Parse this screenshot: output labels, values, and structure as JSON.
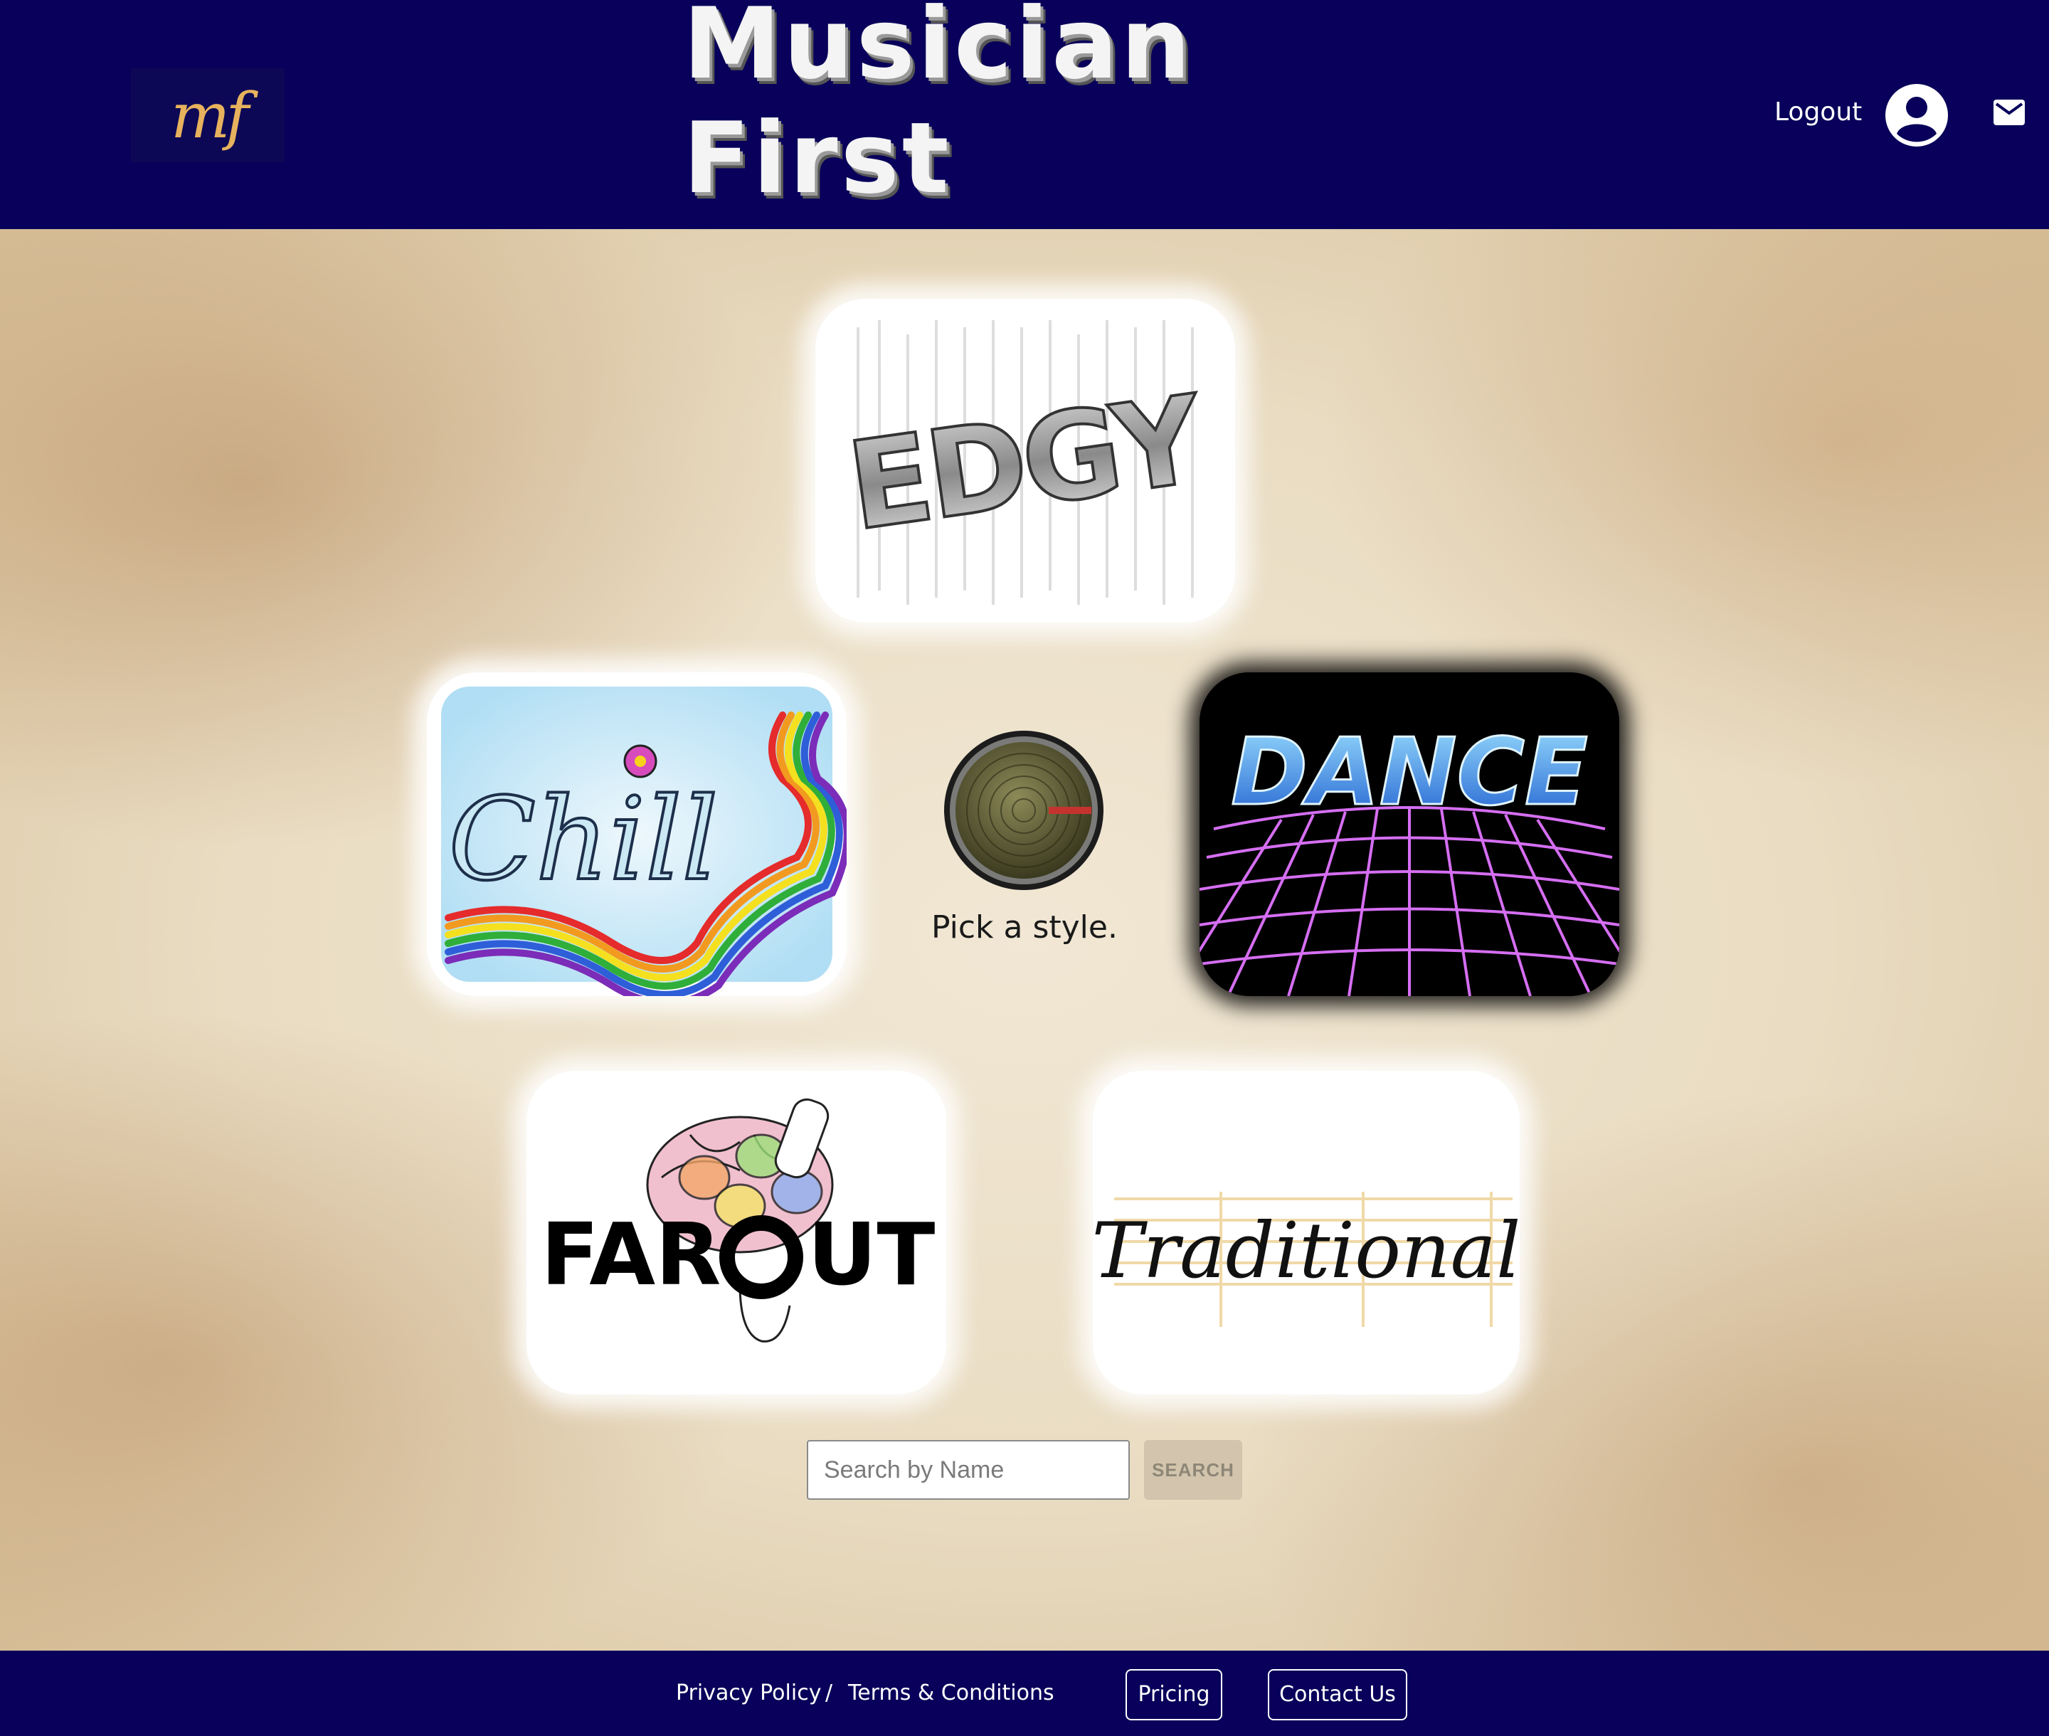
{
  "header": {
    "logo_text": "mf",
    "title": "Musician First",
    "logout_label": "Logout",
    "user_icon": "user-circle-icon",
    "mail_icon": "mail-icon"
  },
  "styles": {
    "edgy": "EDGY",
    "chill": "Chill",
    "dance": "DANCE",
    "farout_left": "FAR",
    "farout_right": "UT",
    "traditional": "Traditional"
  },
  "center": {
    "prompt": "Pick a style.",
    "knob_icon": "volume-knob-icon"
  },
  "search": {
    "placeholder": "Search by Name",
    "value": "",
    "button_label": "SEARCH"
  },
  "footer": {
    "privacy_label": "Privacy Policy",
    "separator": "/",
    "terms_label": "Terms & Conditions",
    "pricing_label": "Pricing",
    "contact_label": "Contact Us"
  },
  "colors": {
    "header_bg": "#08005a",
    "logo_gold": "#e7b25d",
    "parchment": "#e9dcc2",
    "search_button_bg": "#d3c5ad"
  }
}
